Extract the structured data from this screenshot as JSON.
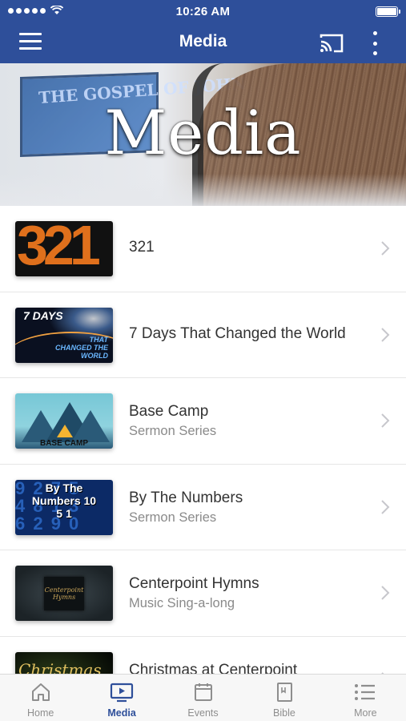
{
  "status": {
    "time": "10:26 AM",
    "signal_dots": 5
  },
  "nav": {
    "title": "Media",
    "icons": [
      "menu-icon",
      "cast-icon",
      "more-vertical-icon"
    ]
  },
  "banner": {
    "title": "Media",
    "screen_text": "THE GOSPEL OF JOHN"
  },
  "colors": {
    "brand": "#2e4f9a",
    "tab_inactive": "#8e8e8e",
    "title_text": "#333333",
    "subtitle_text": "#8a8a8a"
  },
  "items": [
    {
      "title": "321",
      "subtitle": "",
      "thumb_text": "321"
    },
    {
      "title": "7 Days That Changed the World",
      "subtitle": "",
      "thumb_text_top": "7 DAYS",
      "thumb_text_bottom": "THAT CHANGED THE WORLD"
    },
    {
      "title": "Base Camp",
      "subtitle": "Sermon Series",
      "thumb_text": "BASE CAMP"
    },
    {
      "title": "By The Numbers",
      "subtitle": "Sermon Series",
      "thumb_text": "By The Numbers 10 5 1"
    },
    {
      "title": "Centerpoint Hymns",
      "subtitle": "Music Sing-a-long",
      "thumb_text": "Centerpoint Hymns"
    },
    {
      "title": "Christmas at Centerpoint",
      "subtitle": "",
      "thumb_text": "Christmas"
    }
  ],
  "tabs": [
    {
      "label": "Home",
      "icon": "home-icon",
      "active": false
    },
    {
      "label": "Media",
      "icon": "media-tv-icon",
      "active": true
    },
    {
      "label": "Events",
      "icon": "calendar-icon",
      "active": false
    },
    {
      "label": "Bible",
      "icon": "bible-book-icon",
      "active": false
    },
    {
      "label": "More",
      "icon": "list-icon",
      "active": false
    }
  ]
}
